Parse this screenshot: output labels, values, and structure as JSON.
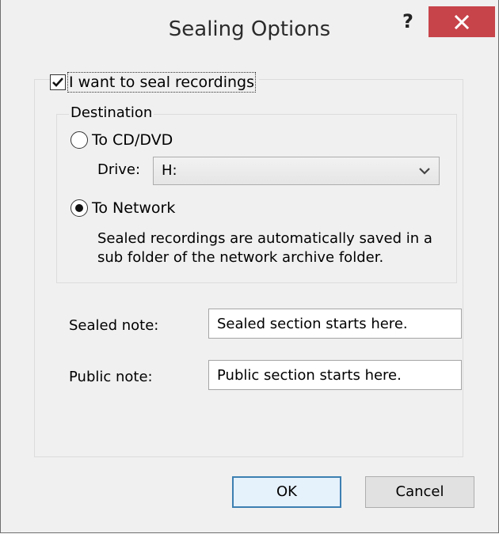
{
  "window": {
    "title": "Sealing Options",
    "help_label": "?",
    "close_color": "#c7444a"
  },
  "seal": {
    "checkbox_label": "I want to seal recordings",
    "checked": true
  },
  "destination": {
    "legend": "Destination",
    "option_cd": "To CD/DVD",
    "drive_label": "Drive:",
    "drive_value": "H:",
    "option_network": "To Network",
    "selected": "To Network",
    "network_desc_line1": "Sealed recordings are automatically saved in a",
    "network_desc_line2": "sub folder of the network archive folder."
  },
  "notes": {
    "sealed_label": "Sealed note:",
    "sealed_value": "Sealed section starts here.",
    "public_label": "Public note:",
    "public_value": "Public section starts here."
  },
  "buttons": {
    "ok": "OK",
    "cancel": "Cancel"
  },
  "icons": {
    "help": "help-icon",
    "close": "close-icon",
    "check": "checkmark-icon",
    "dropdown": "chevron-down-icon"
  }
}
